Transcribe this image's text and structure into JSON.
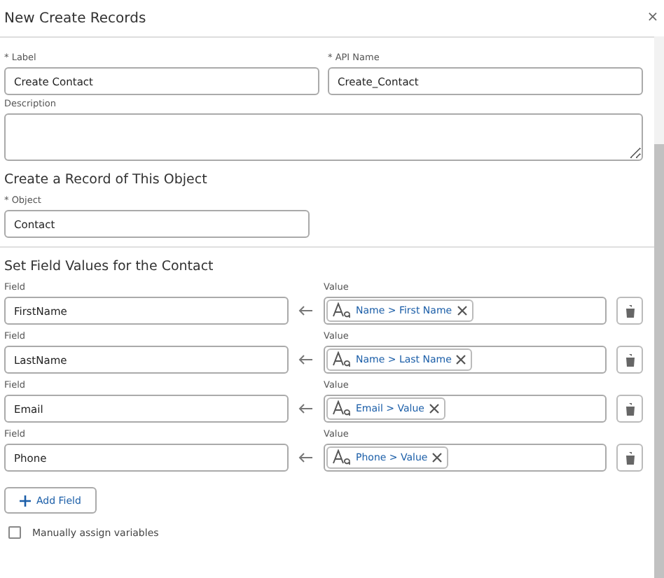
{
  "window": {
    "title": "New Create Records",
    "close": "×"
  },
  "label_field": {
    "label": "* Label",
    "value": "Create Contact"
  },
  "api_name_field": {
    "label": "* API Name",
    "value": "Create_Contact"
  },
  "description_field": {
    "label": "Description"
  },
  "object_section": {
    "heading": "Create a Record of This Object",
    "field": {
      "label": "* Object",
      "value": "Contact"
    }
  },
  "field_values_section": {
    "heading": "Set Field Values for the Contact",
    "rows": [
      {
        "field_label": "Field",
        "field": "FirstName",
        "value_label": "Value",
        "value_pill": "Name > First Name"
      },
      {
        "field_label": "Field",
        "field": "LastName",
        "value_label": "Value",
        "value_pill": "Name > Last Name"
      },
      {
        "field_label": "Field",
        "field": "Email",
        "value_label": "Value",
        "value_pill": "Email > Value"
      },
      {
        "field_label": "Field",
        "field": "Phone",
        "value_label": "Value",
        "value_pill": "Phone > Value"
      }
    ],
    "add_button": "Add Field"
  },
  "manual_assign": {
    "label": "Manually assign variables",
    "checked": false
  }
}
